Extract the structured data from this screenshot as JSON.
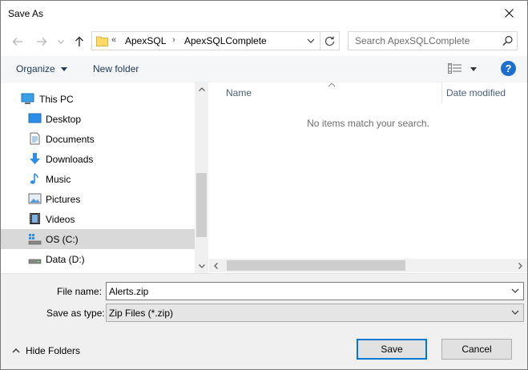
{
  "window": {
    "title": "Save As"
  },
  "navigation": {
    "breadcrumb_overflow": "«",
    "path": [
      "ApexSQL",
      "ApexSQLComplete"
    ],
    "path_separator": "›"
  },
  "search": {
    "placeholder": "Search ApexSQLComplete"
  },
  "toolbar": {
    "organize_label": "Organize",
    "new_folder_label": "New folder",
    "help_label": "?"
  },
  "sidebar": {
    "items": [
      {
        "label": "This PC",
        "icon": "computer-icon"
      },
      {
        "label": "Desktop",
        "icon": "desktop-icon"
      },
      {
        "label": "Documents",
        "icon": "documents-icon"
      },
      {
        "label": "Downloads",
        "icon": "downloads-icon"
      },
      {
        "label": "Music",
        "icon": "music-icon"
      },
      {
        "label": "Pictures",
        "icon": "pictures-icon"
      },
      {
        "label": "Videos",
        "icon": "videos-icon"
      },
      {
        "label": "OS (C:)",
        "icon": "drive-os-icon"
      },
      {
        "label": "Data (D:)",
        "icon": "drive-icon"
      }
    ],
    "selected_index": 7
  },
  "content": {
    "columns": [
      "Name",
      "Date modified"
    ],
    "empty_message": "No items match your search."
  },
  "form": {
    "file_name_label": "File name:",
    "file_name_value": "Alerts.zip",
    "save_as_type_label": "Save as type:",
    "save_as_type_value": "Zip Files (*.zip)"
  },
  "footer": {
    "hide_folders_label": "Hide Folders",
    "save_label": "Save",
    "cancel_label": "Cancel"
  },
  "colors": {
    "accent": "#0078d7",
    "help": "#1d6fcf",
    "selection": "#d9d9d9",
    "toolbar_text": "#1e395b"
  }
}
